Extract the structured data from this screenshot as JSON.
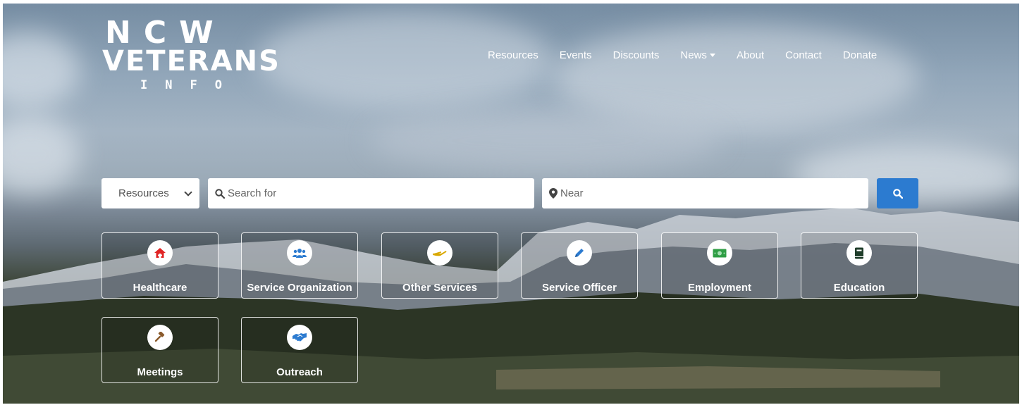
{
  "logo": {
    "line1": "NCW",
    "line2": "VETERANS",
    "line3": "INFO"
  },
  "nav": [
    {
      "label": "Resources"
    },
    {
      "label": "Events"
    },
    {
      "label": "Discounts"
    },
    {
      "label": "News",
      "dropdown": true
    },
    {
      "label": "About"
    },
    {
      "label": "Contact"
    },
    {
      "label": "Donate"
    }
  ],
  "search": {
    "category_selected": "Resources",
    "search_placeholder": "Search for",
    "near_placeholder": "Near",
    "button_icon": "search-icon"
  },
  "categories": [
    {
      "label": "Healthcare",
      "icon": "home-icon",
      "color": "#e02424"
    },
    {
      "label": "Service Organization",
      "icon": "users-icon",
      "color": "#2c7bd0"
    },
    {
      "label": "Other Services",
      "icon": "hand-icon",
      "color": "#d9a800"
    },
    {
      "label": "Service Officer",
      "icon": "pencil-icon",
      "color": "#2c7bd0"
    },
    {
      "label": "Employment",
      "icon": "money-icon",
      "color": "#2f9e44"
    },
    {
      "label": "Education",
      "icon": "book-icon",
      "color": "#1f3d2a"
    },
    {
      "label": "Meetings",
      "icon": "gavel-icon",
      "color": "#8a5a2b"
    },
    {
      "label": "Outreach",
      "icon": "handshake-icon",
      "color": "#2c7bd0"
    }
  ]
}
